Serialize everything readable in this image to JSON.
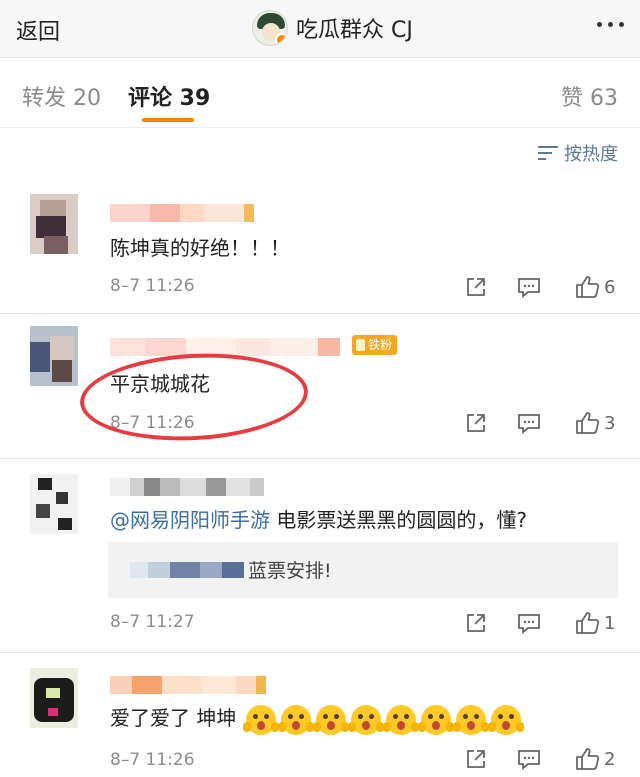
{
  "nav": {
    "back": "返回",
    "title": "吃瓜群众 CJ"
  },
  "tabs": {
    "repost": "转发 20",
    "comments": "评论 39",
    "likes": "赞 63"
  },
  "sort": {
    "label": "按热度"
  },
  "comments": [
    {
      "text": "陈坤真的好绝！！！",
      "time": "8–7 11:26",
      "likes": "6"
    },
    {
      "text": "平京城城花",
      "time": "8–7 11:26",
      "likes": "3",
      "badge": "铁粉"
    },
    {
      "mention": "@网易阴阳师手游",
      "text": " 电影票送黑黑的圆圆的，懂?",
      "time": "8–7 11:27",
      "likes": "1",
      "reply": "蓝票安排!"
    },
    {
      "text": "爱了爱了 坤坤",
      "time": "8–7 11:26",
      "likes": "2"
    }
  ],
  "colors": {
    "accent": "#ff8200",
    "link": "#3b6da8",
    "highlight_circle": "#e83b3f"
  }
}
